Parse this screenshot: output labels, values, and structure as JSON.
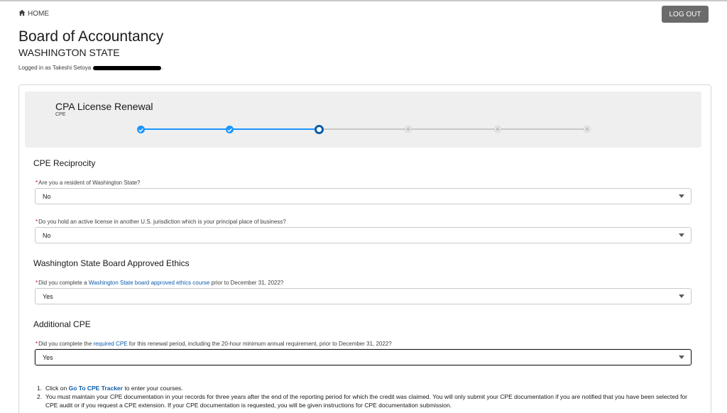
{
  "header": {
    "home_label": "HOME",
    "logout_label": "LOG OUT",
    "board_title": "Board of Accountancy",
    "board_subtitle": "WASHINGTON STATE",
    "logged_in_prefix": "Logged in as Takeshi Setoya",
    "logged_in_suffix": "."
  },
  "path": {
    "title": "CPA License Renewal",
    "subtitle": "CPE",
    "total_steps": 6,
    "completed_steps": 2,
    "current_step": 3
  },
  "sections": {
    "reciprocity": "CPE Reciprocity",
    "ethics": "Washington State Board Approved Ethics",
    "additional": "Additional CPE"
  },
  "questions": [
    {
      "required_marker": "*",
      "text": "Are you a resident of Washington State?",
      "value": "No"
    },
    {
      "required_marker": "*",
      "text": "Do you hold an active license in another U.S. jurisdiction which is your principal place of business?",
      "value": "No"
    },
    {
      "required_marker": "*",
      "text_before": "Did you complete a ",
      "link": "Washington State board approved ethics course",
      "text_after": " prior to December 31, 2022?",
      "value": "Yes"
    },
    {
      "required_marker": "*",
      "text_before": "Did you complete the ",
      "link": "required CPE",
      "text_after": " for this renewal period, including the 20-hour minimum annual requirement, prior to December 31, 2022?",
      "value": "Yes"
    }
  ],
  "instructions": [
    {
      "num": "1.",
      "before": "Click on ",
      "link": "Go To CPE Tracker",
      "after": " to enter your courses."
    },
    {
      "num": "2.",
      "text": "You must maintain your CPE documentation in your records for three years after the end of the reporting period for which the credit was claimed. You will only submit your CPE documentation if you are notified that you have been selected for CPE audit or if you request a CPE extension. If your CPE documentation is requested, you will be given instructions for CPE documentation submission."
    }
  ],
  "colors": {
    "progress": "#1b96ff",
    "link": "#0b5cab",
    "required": "#ba0517",
    "logout_bg": "#6b6b6b"
  },
  "icons": {
    "home": "home-icon",
    "step_done": "check-icon",
    "dropdown": "caret-down-icon"
  }
}
